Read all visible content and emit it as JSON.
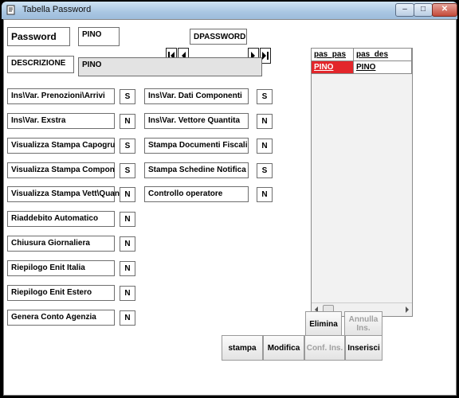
{
  "window": {
    "title": "Tabella Password"
  },
  "header": {
    "password_label": "Password",
    "password_value": "PINO",
    "table_name": "DPASSWORD",
    "descrizione_label": "DESCRIZIONE",
    "descrizione_value": "PINO"
  },
  "options_left": [
    {
      "label": "Ins\\Var. Prenozioni\\Arrivi",
      "value": "S"
    },
    {
      "label": "Ins\\Var. Exstra",
      "value": "N"
    },
    {
      "label": "Visualizza Stampa Capogru",
      "value": "S"
    },
    {
      "label": "Visualizza Stampa Compon",
      "value": "S"
    },
    {
      "label": "Visualizza Stampa Vett\\Quan",
      "value": "N"
    },
    {
      "label": "Riaddebito Automatico",
      "value": "N"
    },
    {
      "label": "Chiusura Giornaliera",
      "value": "N"
    },
    {
      "label": "Riepilogo Enit Italia",
      "value": "N"
    },
    {
      "label": "Riepilogo Enit Estero",
      "value": "N"
    },
    {
      "label": "Genera Conto Agenzia",
      "value": "N"
    }
  ],
  "options_right": [
    {
      "label": "Ins\\Var. Dati Componenti",
      "value": "S"
    },
    {
      "label": "Ins\\Var. Vettore Quantita",
      "value": "N"
    },
    {
      "label": "Stampa Documenti Fiscali",
      "value": "N"
    },
    {
      "label": "Stampa Schedine Notifica",
      "value": "S"
    },
    {
      "label": "Controllo operatore",
      "value": "N"
    }
  ],
  "grid": {
    "columns": [
      "pas_pas",
      "pas_des"
    ],
    "rows": [
      [
        "PINO",
        "PINO"
      ]
    ]
  },
  "buttons": {
    "elimina": "Elimina",
    "annulla": "Annulla Ins.",
    "stampa": "stampa",
    "modifica": "Modifica",
    "conf_ins": "Conf. Ins.",
    "inserisci": "Inserisci"
  },
  "colors": {
    "selected_row": "#e3262b",
    "titlebar": "#a9c6e2"
  }
}
